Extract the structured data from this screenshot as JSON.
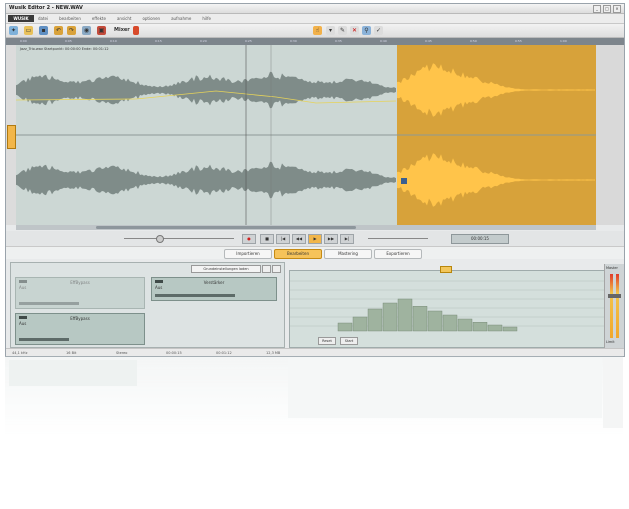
{
  "window": {
    "title": "Wusik Editor 2 - NEW.WAV",
    "controls": [
      "_",
      "□",
      "×"
    ]
  },
  "menubar": {
    "logo": "WUSIK",
    "items": [
      "datei",
      "bearbeiten",
      "effekte",
      "ansicht",
      "optionen",
      "aufnahme",
      "hilfe"
    ]
  },
  "toolbar": {
    "mixer_label": "Mixer"
  },
  "ruler": {
    "ticks": [
      "0:00",
      "0:05",
      "0:10",
      "0:15",
      "0:20",
      "0:25",
      "0:30",
      "0:35",
      "0:40",
      "0:45",
      "0:50",
      "0:55",
      "1:00"
    ]
  },
  "waveform": {
    "file_label": "Jazz_Trio.wav  Startpunkt: 00:00:00  Ende: 00:01:12",
    "bg_color": "#ccd7d4",
    "selection_color": "#d7a23a"
  },
  "transport": {
    "buttons": [
      "●",
      "■",
      "|◀",
      "◀◀",
      "▶",
      "▶▶",
      "▶|"
    ],
    "time_right": "00:00:15"
  },
  "tabs": [
    {
      "label": "Importieren",
      "active": false
    },
    {
      "label": "Bearbeiten",
      "active": true
    },
    {
      "label": "Mastering",
      "active": false
    },
    {
      "label": "Exportieren",
      "active": false
    }
  ],
  "effects_panel": {
    "preset_select": "Grundeinstellungen laden",
    "devices": [
      {
        "name": "EffBypass",
        "mode": "Aus"
      },
      {
        "name": "Verstärker",
        "mode": "Aus"
      },
      {
        "name": "EffBypass",
        "mode": "Aus"
      }
    ]
  },
  "graph_panel": {
    "button_left": "Reset",
    "button_right": "Start",
    "bars": [
      0.2,
      0.35,
      0.55,
      0.7,
      0.8,
      0.62,
      0.5,
      0.4,
      0.3,
      0.22,
      0.15,
      0.1
    ]
  },
  "meter": {
    "label_top": "Master",
    "label_bottom": "Limit"
  },
  "statusbar": {
    "items": [
      "44,1 kHz",
      "16 Bit",
      "Stereo",
      "00:00:15",
      "00:01:12",
      "12,3 MB"
    ]
  }
}
